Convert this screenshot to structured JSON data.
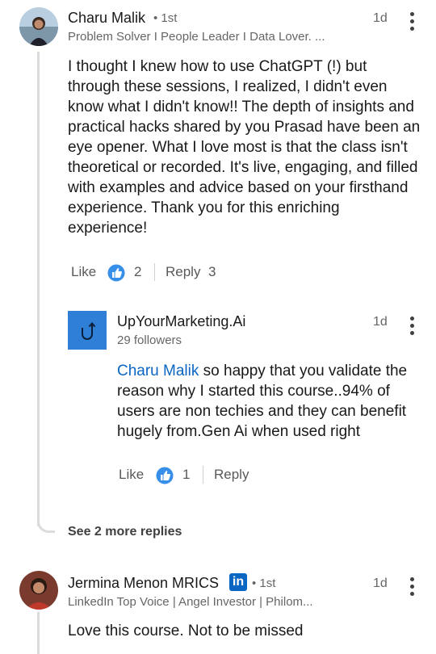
{
  "comments": [
    {
      "author": "Charu Malik",
      "degree": "• 1st",
      "headline": "Problem Solver I People Leader I Data Lover. ...",
      "time": "1d",
      "text": "I thought I knew how to use ChatGPT (!) but through these sessions, I realized, I didn't even know what I didn't know!! The depth of insights and practical hacks shared by you Prasad have been an eye opener. What I love most is that the class isn't theoretical or recorded. It's live, engaging, and filled with examples and advice based on your firsthand experience. Thank you for this enriching experience!",
      "like_label": "Like",
      "like_count": "2",
      "reply_label": "Reply",
      "reply_count": "3",
      "reply": {
        "author": "UpYourMarketing.Ai",
        "followers": "29 followers",
        "time": "1d",
        "mention": "Charu Malik",
        "text": " so happy that you validate the reason why I started this course..94% of users are non techies and they can benefit hugely from.Gen Ai when used right",
        "like_label": "Like",
        "like_count": "1",
        "reply_label": "Reply"
      },
      "see_more": "See 2 more replies"
    },
    {
      "author": "Jermina Menon MRICS",
      "degree": "• 1st",
      "headline": "LinkedIn Top Voice | Angel Investor | Philom...",
      "time": "1d",
      "text": "Love this course. Not to be missed",
      "badge": "in"
    }
  ],
  "colors": {
    "brand_blue": "#0a66c2",
    "logo_bg": "#2f7fd6",
    "thread_line": "#dcdcdc"
  }
}
